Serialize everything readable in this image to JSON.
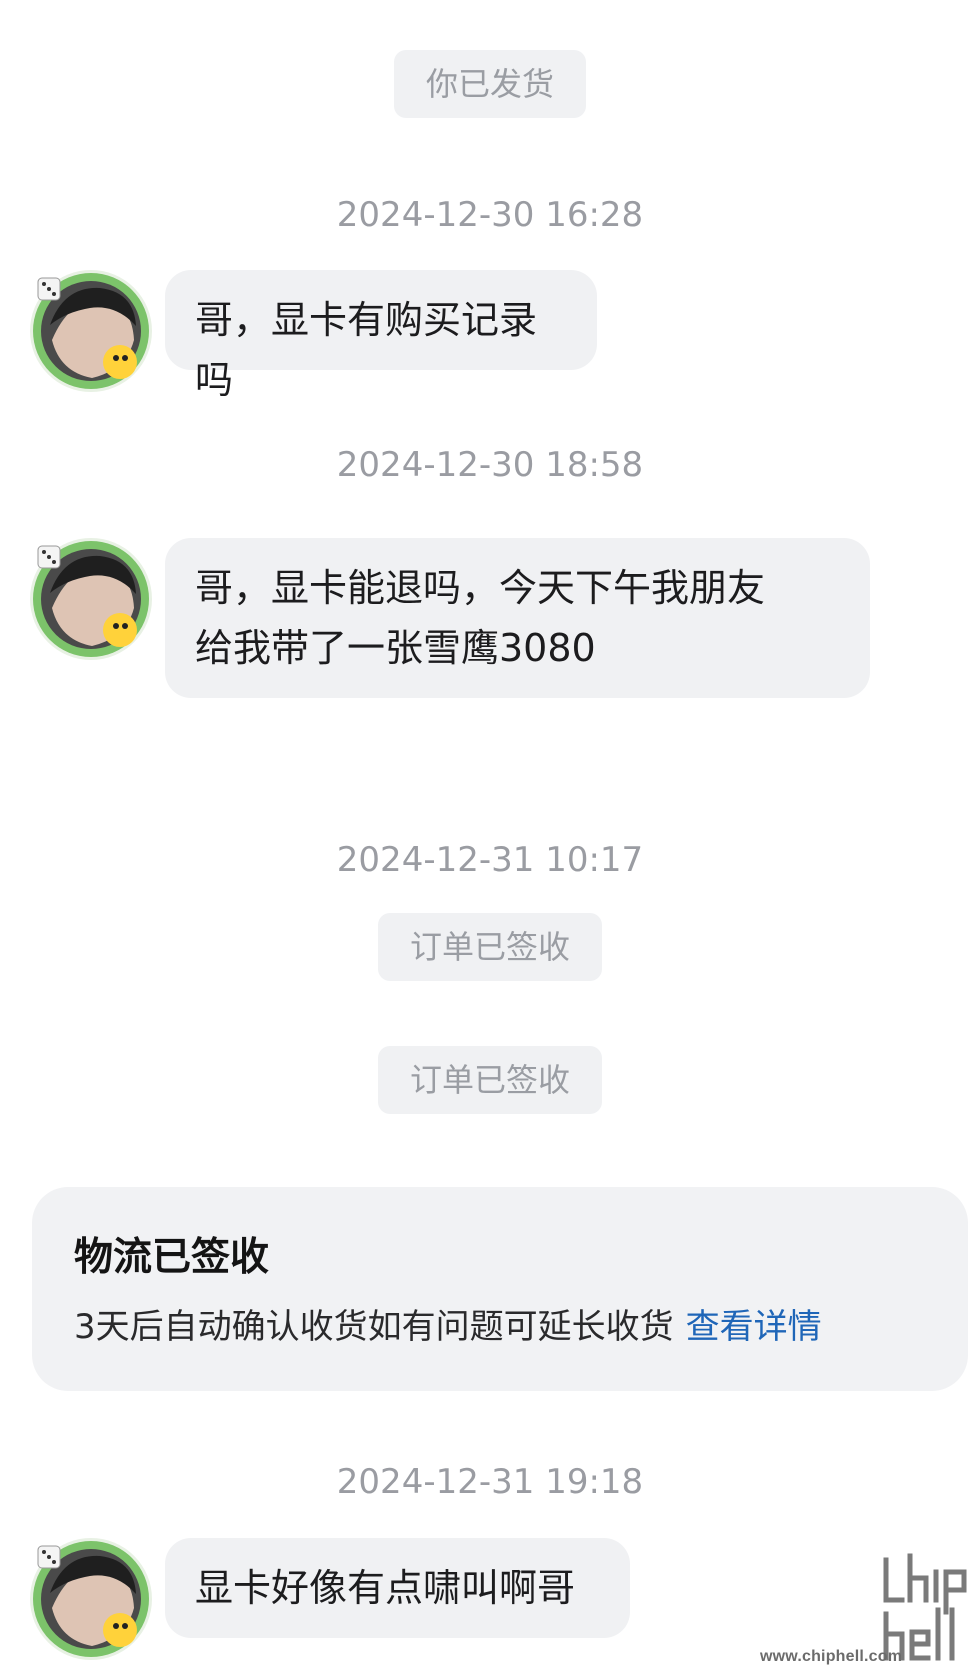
{
  "messages": {
    "shipped_notice": "你已发货",
    "time_1": "2024-12-30 16:28",
    "msg_1": "哥，显卡有购买记录吗",
    "time_2": "2024-12-30 18:58",
    "msg_2_line1": "哥，显卡能退吗，今天下午我朋友",
    "msg_2_line2": "给我带了一张雪鹰3080",
    "time_3": "2024-12-31 10:17",
    "signed_notice_1": "订单已签收",
    "signed_notice_2": "订单已签收",
    "time_4": "2024-12-31 19:18",
    "msg_3": "显卡好像有点啸叫啊哥"
  },
  "logistics_card": {
    "title": "物流已签收",
    "body": "3天后自动确认收货如有问题可延长收货",
    "link": "查看详情"
  },
  "watermark": {
    "url": "www.chiphell.com",
    "logo_icon": "chiphell-logo"
  },
  "colors": {
    "bubble_bg": "#f0f1f3",
    "link": "#1f66b8",
    "timestamp": "#9a9ca2"
  }
}
